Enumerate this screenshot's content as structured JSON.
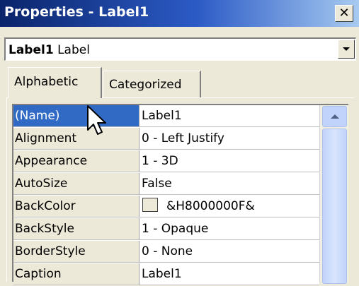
{
  "window": {
    "title": "Properties - Label1",
    "close_glyph": "✕"
  },
  "object_selector": {
    "name": "Label1",
    "type": "Label"
  },
  "tabs": [
    {
      "label": "Alphabetic",
      "active": true
    },
    {
      "label": "Categorized",
      "active": false
    }
  ],
  "properties": [
    {
      "name": "(Name)",
      "value": "Label1",
      "selected": true
    },
    {
      "name": "Alignment",
      "value": "0 - Left Justify"
    },
    {
      "name": "Appearance",
      "value": "1 - 3D"
    },
    {
      "name": "AutoSize",
      "value": "False"
    },
    {
      "name": "BackColor",
      "value": "&H8000000F&",
      "swatch_color": "#ece9d8"
    },
    {
      "name": "BackStyle",
      "value": "1 - Opaque"
    },
    {
      "name": "BorderStyle",
      "value": "0 - None"
    },
    {
      "name": "Caption",
      "value": "Label1"
    }
  ],
  "colors": {
    "selection": "#316ac5",
    "title_gradient_start": "#0a246a",
    "title_gradient_end": "#a6caf0",
    "face": "#ece9d8"
  },
  "icons": {
    "close": "close-icon",
    "dropdown": "chevron-down-icon",
    "scroll_up": "scroll-up-arrow-icon",
    "cursor": "mouse-pointer-icon"
  }
}
